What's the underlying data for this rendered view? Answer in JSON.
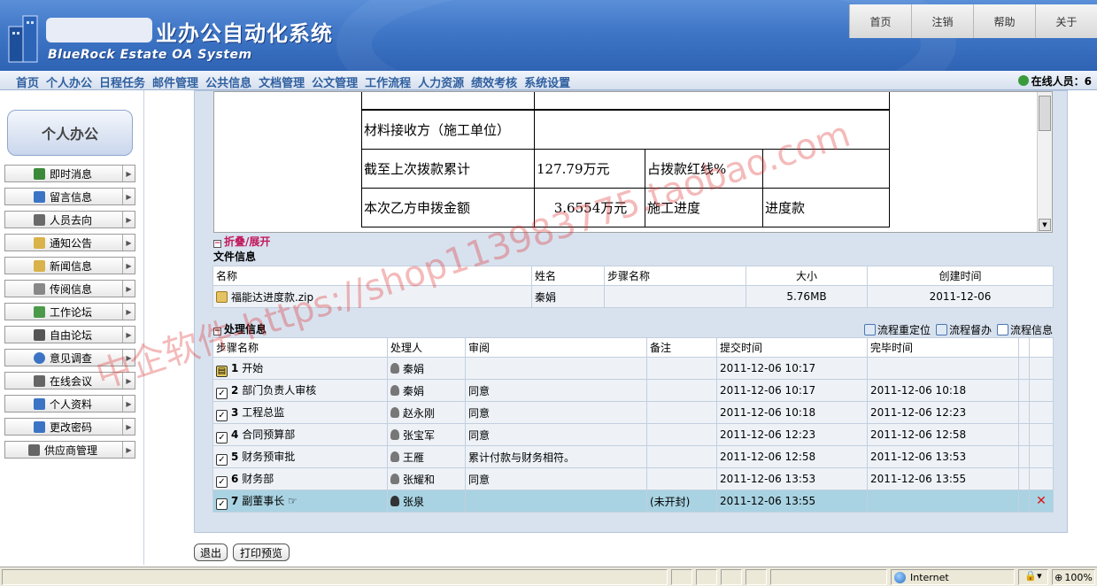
{
  "header": {
    "app_title": "业办公自动化系统",
    "app_subtitle": "BlueRock Estate OA System",
    "top_links": [
      "首页",
      "注销",
      "帮助",
      "关于"
    ]
  },
  "nav": {
    "items": [
      "首页",
      "个人办公",
      "日程任务",
      "邮件管理",
      "公共信息",
      "文档管理",
      "公文管理",
      "工作流程",
      "人力资源",
      "绩效考核",
      "系统设置"
    ],
    "online_label": "在线人员：6"
  },
  "sidebar": {
    "title": "个人办公",
    "items": [
      {
        "label": "即时消息",
        "color": "#3a8a3a"
      },
      {
        "label": "留言信息",
        "color": "#3b74c4"
      },
      {
        "label": "人员去向",
        "color": "#6a6a6a"
      },
      {
        "label": "通知公告",
        "color": "#d9b24a"
      },
      {
        "label": "新闻信息",
        "color": "#d9b24a"
      },
      {
        "label": "传阅信息",
        "color": "#888888"
      },
      {
        "label": "工作论坛",
        "color": "#4a9a4a"
      },
      {
        "label": "自由论坛",
        "color": "#555555"
      },
      {
        "label": "意见调查",
        "color": "#3b74c4"
      },
      {
        "label": "在线会议",
        "color": "#666666"
      },
      {
        "label": "个人资料",
        "color": "#3b74c4"
      },
      {
        "label": "更改密码",
        "color": "#3b74c4"
      },
      {
        "label": "供应商管理",
        "color": "#666666"
      }
    ]
  },
  "document": {
    "rows": [
      {
        "label": "材料接收方（施工单位）"
      },
      {
        "label": "截至上次拨款累计",
        "value": "127.79万元",
        "label2": "占拨款红线%",
        "value2": ""
      },
      {
        "label": "本次乙方申拨金额",
        "value": "3.6554万元",
        "label2": "施工进度",
        "value2": "进度款"
      }
    ]
  },
  "collapse_label": "折叠/展开",
  "file_section": {
    "title": "文件信息",
    "headers": [
      "名称",
      "姓名",
      "步骤名称",
      "大小",
      "创建时间"
    ],
    "rows": [
      {
        "name": "福能达进度款.zip",
        "person": "秦娟",
        "step": "",
        "size": "5.76MB",
        "created": "2011-12-06"
      }
    ]
  },
  "process_section": {
    "title": "处理信息",
    "links": [
      "流程重定位",
      "流程督办",
      "流程信息"
    ],
    "headers": [
      "步骤名称",
      "处理人",
      "审阅",
      "备注",
      "提交时间",
      "完毕时间"
    ],
    "rows": [
      {
        "num": "1",
        "step": "开始",
        "handler": "秦娟",
        "review": "",
        "note": "",
        "submitted": "2011-12-06 10:17",
        "finished": ""
      },
      {
        "num": "2",
        "step": "部门负责人审核",
        "handler": "秦娟",
        "review": "同意",
        "note": "",
        "submitted": "2011-12-06 10:17",
        "finished": "2011-12-06 10:18"
      },
      {
        "num": "3",
        "step": "工程总监",
        "handler": "赵永刚",
        "review": "同意",
        "note": "",
        "submitted": "2011-12-06 10:18",
        "finished": "2011-12-06 12:23"
      },
      {
        "num": "4",
        "step": "合同预算部",
        "handler": "张宝军",
        "review": "同意",
        "note": "",
        "submitted": "2011-12-06 12:23",
        "finished": "2011-12-06 12:58"
      },
      {
        "num": "5",
        "step": "财务预审批",
        "handler": "王雁",
        "review": "累计付款与财务相符。",
        "note": "",
        "submitted": "2011-12-06 12:58",
        "finished": "2011-12-06 13:53"
      },
      {
        "num": "6",
        "step": "财务部",
        "handler": "张耀和",
        "review": "同意",
        "note": "",
        "submitted": "2011-12-06 13:53",
        "finished": "2011-12-06 13:55"
      },
      {
        "num": "7",
        "step": "副董事长",
        "handler": "张泉",
        "review": "",
        "note": "(未开封)",
        "submitted": "2011-12-06 13:55",
        "finished": ""
      }
    ]
  },
  "buttons": {
    "exit": "退出",
    "print": "打印预览"
  },
  "statusbar": {
    "zone": "Internet",
    "zoom": "100%"
  },
  "watermark": "中企软件-https://shop113983775.taobao.com"
}
